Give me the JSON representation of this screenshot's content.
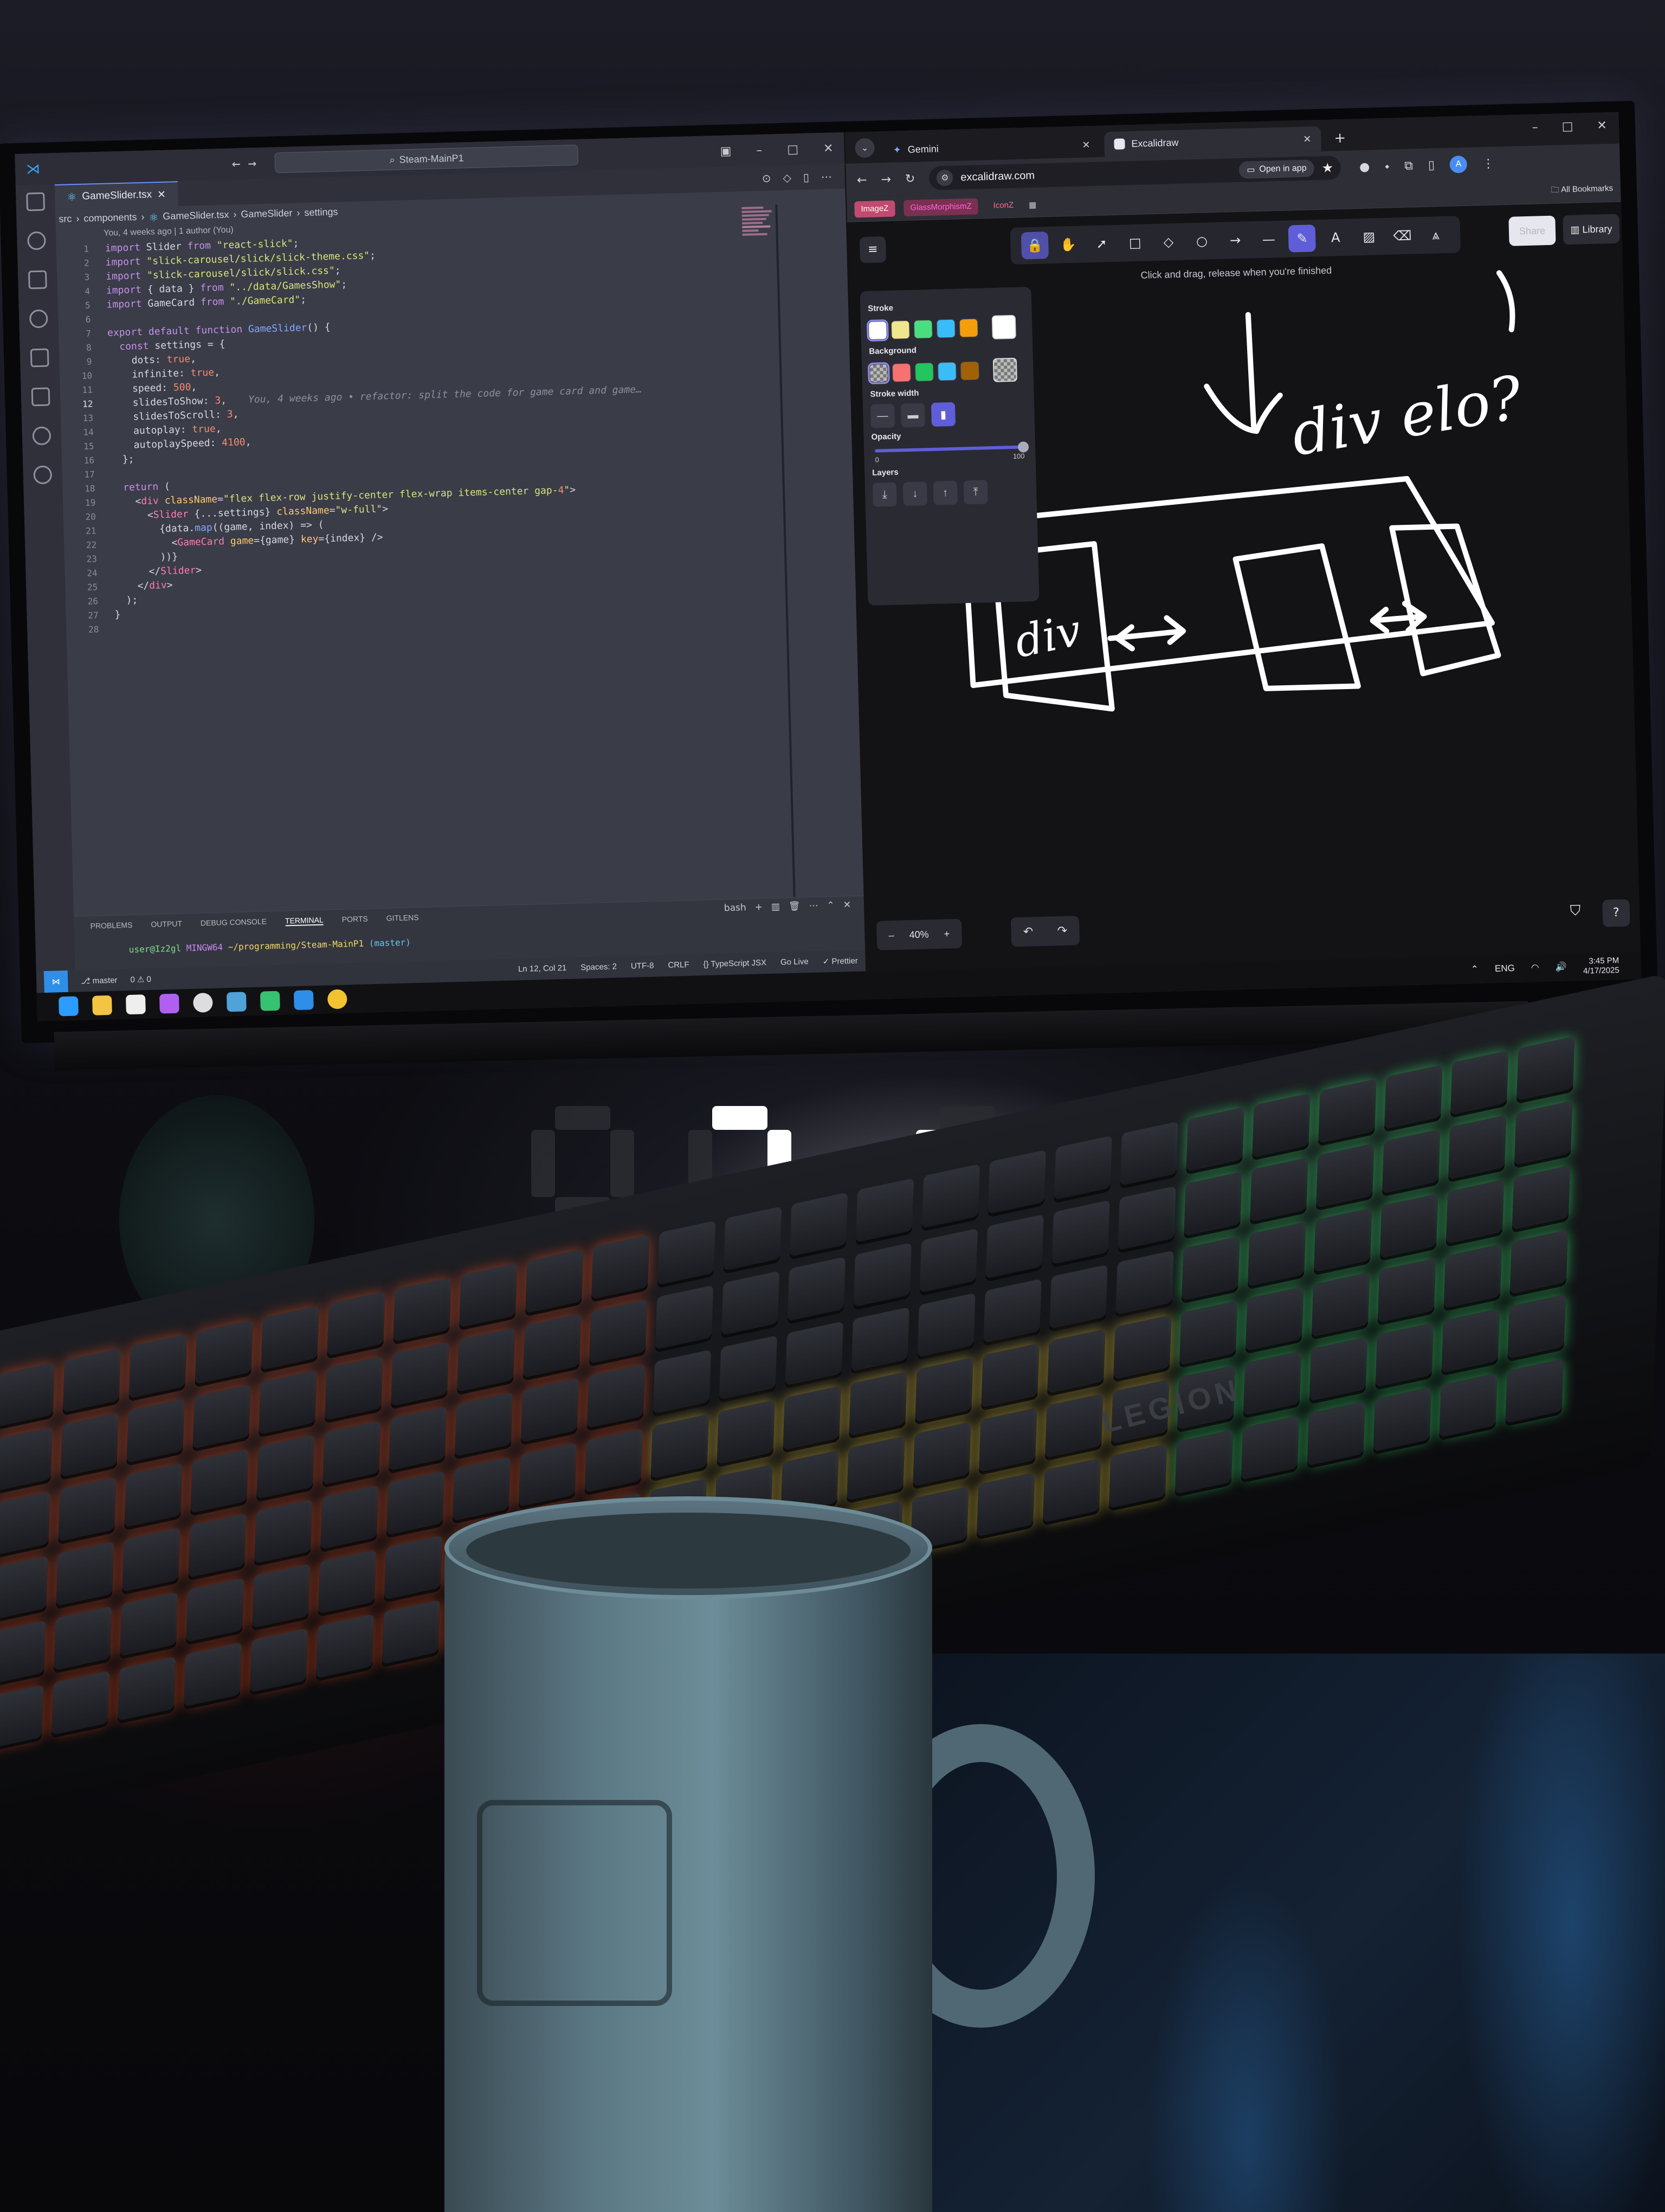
{
  "scene": {
    "desk_clock": {
      "hours": "3",
      "minutes": "45"
    },
    "keyboard_brand": "LEGION"
  },
  "vscode": {
    "search_text": "Steam-MainP1",
    "tab_label": "GameSlider.tsx",
    "breadcrumb": [
      "src",
      "components",
      "GameSlider.tsx",
      "GameSlider",
      "settings"
    ],
    "blame_header": "You, 4 weeks ago | 1 author (You)",
    "inline_blame": "You, 4 weeks ago • refactor: split the code for game card and game…",
    "code_lines": [
      "import Slider from \"react-slick\";",
      "import \"slick-carousel/slick/slick-theme.css\";",
      "import \"slick-carousel/slick/slick.css\";",
      "import { data } from \"../data/GamesShow\";",
      "import GameCard from \"./GameCard\";",
      "",
      "export default function GameSlider() {",
      "  const settings = {",
      "    dots: true,",
      "    infinite: true,",
      "    speed: 500,",
      "    slidesToShow: 3,",
      "    slidesToScroll: 3,",
      "    autoplay: true,",
      "    autoplaySpeed: 4100,",
      "  };",
      "",
      "  return (",
      "    <div className=\"flex flex-row justify-center flex-wrap items-center gap-4\">",
      "      <Slider {...settings} className=\"w-full\">",
      "        {data.map((game, index) => (",
      "          <GameCard game={game} key={index} />",
      "        ))}",
      "      </Slider>",
      "    </div>",
      "  );",
      "}",
      ""
    ],
    "current_line": 12,
    "panel_tabs": [
      "PROBLEMS",
      "OUTPUT",
      "DEBUG CONSOLE",
      "TERMINAL",
      "PORTS",
      "GITLENS"
    ],
    "active_panel_tab": "TERMINAL",
    "terminal_shell": "bash",
    "terminal_prompt": {
      "user": "user@Iz2gl",
      "host": "MINGW64",
      "path": "~/programming/Steam-MainP1",
      "branch": "(master)"
    },
    "status": {
      "branch": "master",
      "problems": "0 ⚠ 0",
      "cursor": "Ln 12, Col 21",
      "spaces": "Spaces: 2",
      "encoding": "UTF-8",
      "eol": "CRLF",
      "language": "{} TypeScript JSX",
      "golive": "Go Live",
      "prettier": "✓ Prettier"
    }
  },
  "browser": {
    "tabs": [
      {
        "label": "Gemini",
        "active": false
      },
      {
        "label": "Excalidraw",
        "active": true
      }
    ],
    "url": "excalidraw.com",
    "open_in_app": "Open in app",
    "avatar_letter": "A",
    "bookmarks": [
      "ImageZ",
      "GlassMorphismZ",
      "IconZ"
    ],
    "all_bookmarks": "All Bookmarks"
  },
  "excalidraw": {
    "hint": "Click and drag, release when you're finished",
    "share": "Share",
    "library": "Library",
    "props": {
      "stroke": "Stroke",
      "background": "Background",
      "stroke_width": "Stroke width",
      "opacity": "Opacity",
      "opacity_min": "0",
      "opacity_max": "100",
      "layers": "Layers"
    },
    "stroke_colors": [
      "#ffffff",
      "#f0e68c",
      "#4ade80",
      "#38bdf8",
      "#f59e0b"
    ],
    "background_colors": [
      "transparent",
      "#f87171",
      "#22c55e",
      "#38bdf8",
      "#a16207"
    ],
    "zoom": "40%",
    "sketch_text": {
      "main_div": "div",
      "question": "div elo?",
      "inner_div": "div"
    }
  },
  "taskbar": {
    "time": "3:45 PM",
    "date": "4/17/2025",
    "lang": "ENG"
  }
}
